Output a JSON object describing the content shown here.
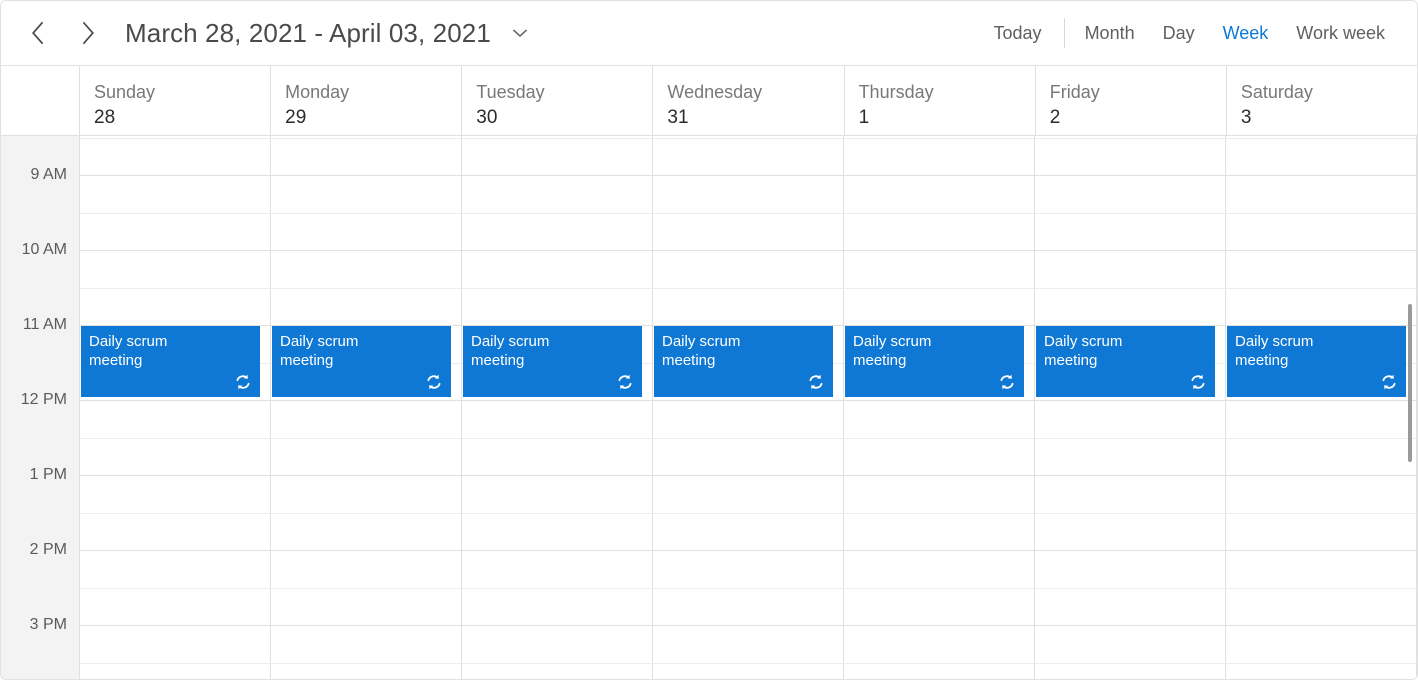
{
  "toolbar": {
    "prev_label": "Previous period",
    "next_label": "Next period",
    "date_range": "March 28, 2021 - April 03, 2021",
    "dropdown_label": "Open date picker",
    "today_label": "Today",
    "views": [
      {
        "label": "Month",
        "active": false
      },
      {
        "label": "Day",
        "active": false
      },
      {
        "label": "Week",
        "active": true
      },
      {
        "label": "Work week",
        "active": false
      }
    ]
  },
  "calendar": {
    "days": [
      {
        "name": "Sunday",
        "date": "28"
      },
      {
        "name": "Monday",
        "date": "29"
      },
      {
        "name": "Tuesday",
        "date": "30"
      },
      {
        "name": "Wednesday",
        "date": "31"
      },
      {
        "name": "Thursday",
        "date": "1"
      },
      {
        "name": "Friday",
        "date": "2"
      },
      {
        "name": "Saturday",
        "date": "3"
      }
    ],
    "time_labels": [
      "9 AM",
      "10 AM",
      "11 AM",
      "12 PM",
      "1 PM",
      "2 PM",
      "3 PM"
    ],
    "event_title": "Daily scrum\nmeeting",
    "event_color": "#0f78d4",
    "events": [
      {
        "day": 0,
        "title": "Daily scrum\nmeeting",
        "recurring": true
      },
      {
        "day": 1,
        "title": "Daily scrum\nmeeting",
        "recurring": true
      },
      {
        "day": 2,
        "title": "Daily scrum\nmeeting",
        "recurring": true
      },
      {
        "day": 3,
        "title": "Daily scrum\nmeeting",
        "recurring": true
      },
      {
        "day": 4,
        "title": "Daily scrum\nmeeting",
        "recurring": true
      },
      {
        "day": 5,
        "title": "Daily scrum\nmeeting",
        "recurring": true
      },
      {
        "day": 6,
        "title": "Daily scrum\nmeeting",
        "recurring": true
      }
    ]
  }
}
